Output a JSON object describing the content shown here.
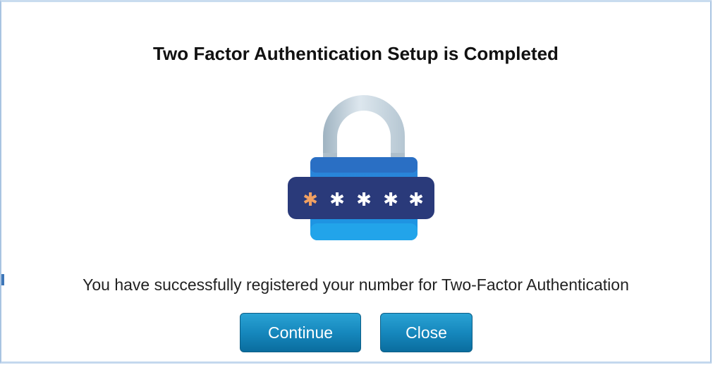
{
  "dialog": {
    "title": "Two Factor Authentication Setup is Completed",
    "message": "You have successfully registered your number for Two-Factor Authentication",
    "icon": "padlock-password-icon",
    "buttons": {
      "continue_label": "Continue",
      "close_label": "Close"
    }
  },
  "colors": {
    "button": "#1688bd",
    "lock_body": "#2b8fe0",
    "lock_band": "#2a3a7a",
    "shackle": "#c7d6e0",
    "first_asterisk": "#f0a062",
    "asterisk": "#ffffff"
  }
}
